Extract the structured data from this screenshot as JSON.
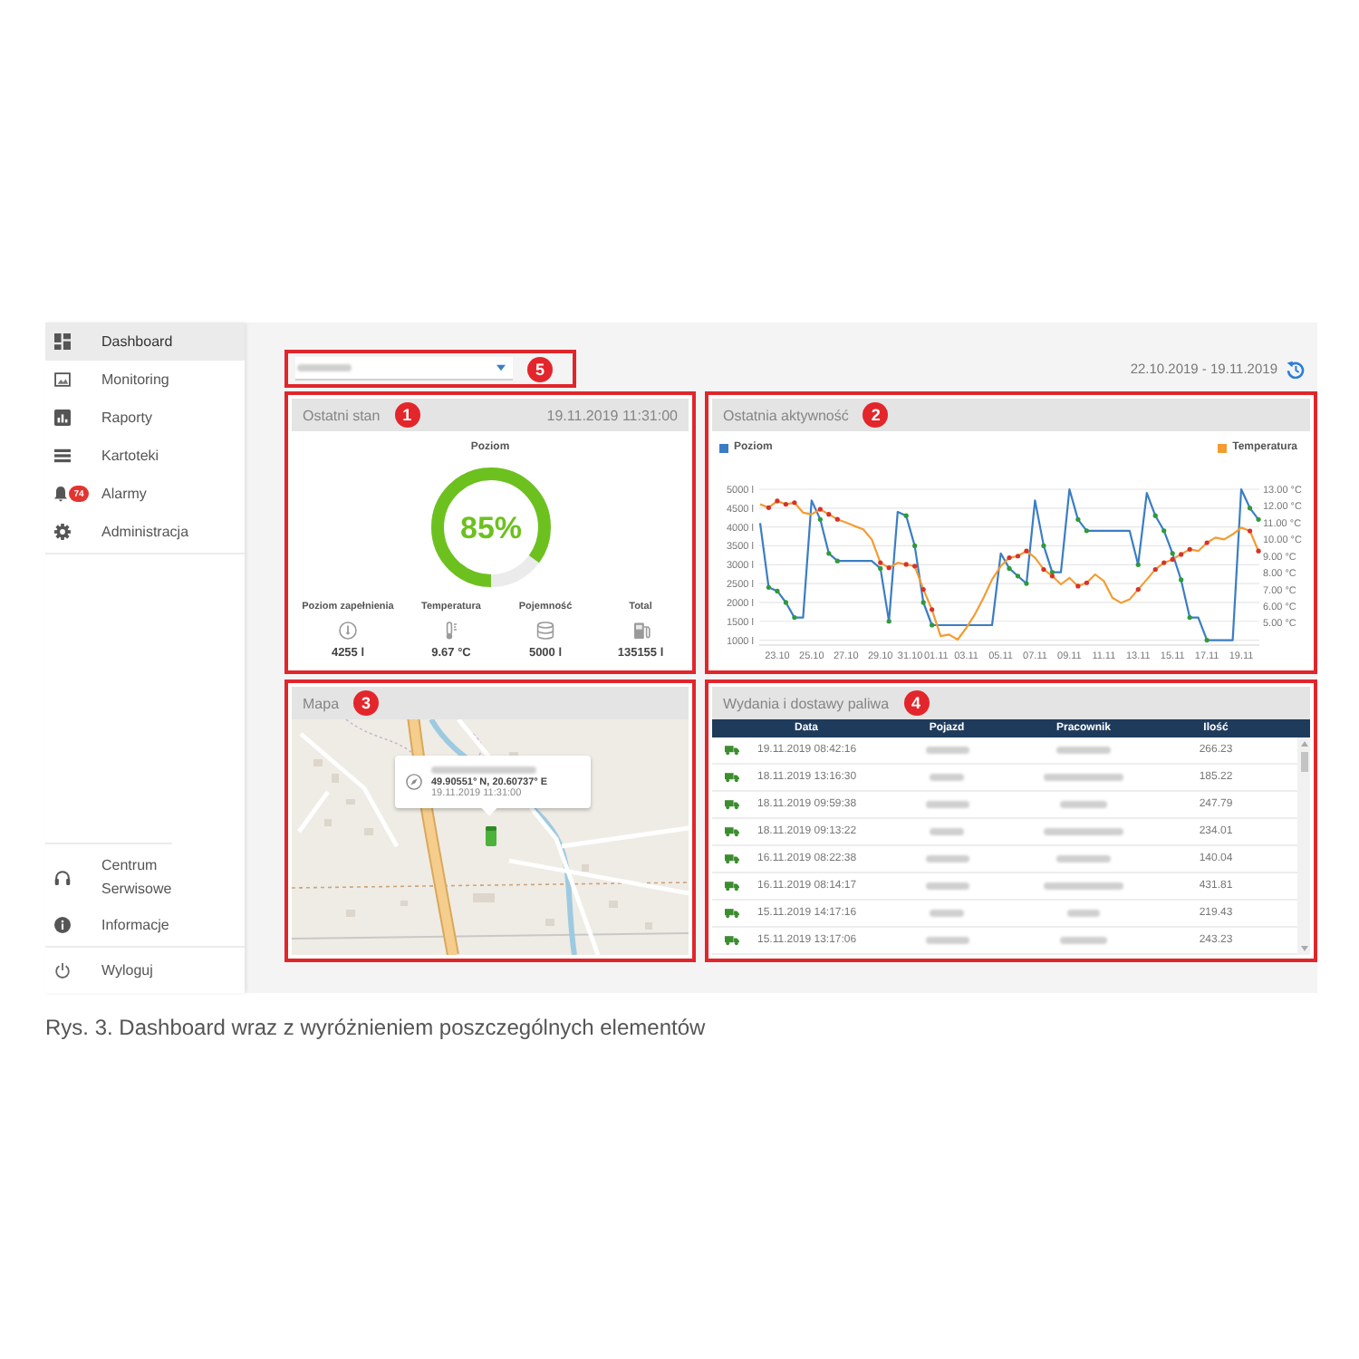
{
  "sidebar": {
    "items": [
      {
        "label": "Dashboard",
        "selected": true
      },
      {
        "label": "Monitoring",
        "selected": false
      },
      {
        "label": "Raporty",
        "selected": false
      },
      {
        "label": "Kartoteki",
        "selected": false
      },
      {
        "label": "Alarmy",
        "selected": false,
        "badge": "74"
      },
      {
        "label": "Administracja",
        "selected": false
      }
    ],
    "footer_items": [
      {
        "label": "Centrum Serwisowe"
      },
      {
        "label": "Informacje"
      },
      {
        "label": "Wyloguj"
      }
    ]
  },
  "toolbar": {
    "selector": {
      "callout": "5"
    },
    "date_range": "22.10.2019 - 19.11.2019"
  },
  "status_panel": {
    "title": "Ostatni stan",
    "callout": "1",
    "timestamp": "19.11.2019 11:31:00",
    "gauge": {
      "label": "Poziom",
      "level": 0.85,
      "reading": "85%"
    },
    "stats": [
      {
        "label": "Poziom zapełnienia",
        "value": "4255 l"
      },
      {
        "label": "Temperatura",
        "value": "9.67 °C"
      },
      {
        "label": "Pojemność",
        "value": "5000 l"
      },
      {
        "label": "Total",
        "value": "135155 l"
      }
    ]
  },
  "activity_panel": {
    "title": "Ostatnia aktywność",
    "callout": "2",
    "chart_data": {
      "type": "line",
      "grid": true,
      "categories": [
        null,
        null,
        "23.10",
        null,
        null,
        null,
        "25.10",
        null,
        null,
        null,
        "27.10",
        null,
        null,
        null,
        "29.10",
        null,
        null,
        null,
        "31.10",
        null,
        "01.11",
        null,
        null,
        null,
        "03.11",
        null,
        null,
        null,
        "05.11",
        null,
        null,
        null,
        "07.11",
        null,
        null,
        null,
        "09.11",
        null,
        null,
        null,
        "11.11",
        null,
        null,
        null,
        "13.11",
        null,
        null,
        null,
        "15.11",
        null,
        null,
        null,
        "17.11",
        null,
        null,
        null,
        "19.11",
        null,
        null
      ],
      "ylim": [
        870,
        5000
      ],
      "yticks": [
        {
          "value": 1000,
          "label": "1000 l"
        },
        {
          "value": 1500,
          "label": "1500 l"
        },
        {
          "value": 2000,
          "label": "2000 l"
        },
        {
          "value": 2500,
          "label": "2500 l"
        },
        {
          "value": 3000,
          "label": "3000 l"
        },
        {
          "value": 3500,
          "label": "3500 l"
        },
        {
          "value": 4000,
          "label": "4000 l"
        },
        {
          "value": 4500,
          "label": "4500 l"
        },
        {
          "value": 5000,
          "label": "5000 l"
        }
      ],
      "y2lim": [
        3.67,
        13
      ],
      "y2ticks": [
        {
          "value": 5,
          "label": "5.00 °C"
        },
        {
          "value": 6,
          "label": "6.00 °C"
        },
        {
          "value": 7,
          "label": "7.00 °C"
        },
        {
          "value": 8,
          "label": "8.00 °C"
        },
        {
          "value": 9,
          "label": "9.00 °C"
        },
        {
          "value": 10,
          "label": "10.00 °C"
        },
        {
          "value": 11,
          "label": "11.00 °C"
        },
        {
          "value": 12,
          "label": "12.00 °C"
        },
        {
          "value": 13,
          "label": "13.00 °C"
        }
      ],
      "series": [
        {
          "name": "Poziom",
          "color": "#3b7dc4",
          "values": [
            4100,
            2400,
            2300,
            2000,
            1600,
            1600,
            4700,
            4200,
            3300,
            3100,
            3100,
            3100,
            3100,
            3100,
            2900,
            1500,
            4400,
            4300,
            3500,
            2000,
            1400,
            1400,
            1400,
            1400,
            1400,
            1400,
            1400,
            1400,
            3300,
            2900,
            2700,
            2500,
            4700,
            3500,
            2800,
            2800,
            5000,
            4200,
            3900,
            3900,
            3900,
            3900,
            3900,
            3900,
            3000,
            4900,
            4300,
            3900,
            3300,
            2600,
            1600,
            1600,
            1000,
            1000,
            1000,
            1000,
            5000,
            4500,
            4200
          ]
        },
        {
          "name": "Temperatura",
          "color": "#f39c32",
          "axis": "y2",
          "values": [
            12.1,
            11.9,
            12.3,
            12.1,
            12.2,
            11.6,
            11.5,
            11.8,
            11.5,
            11.2,
            11.0,
            10.8,
            10.6,
            10.0,
            8.6,
            8.3,
            8.6,
            8.5,
            8.4,
            7.0,
            5.8,
            4.2,
            4.3,
            4.0,
            4.7,
            5.5,
            6.5,
            7.6,
            8.4,
            8.9,
            9.0,
            9.3,
            8.9,
            8.2,
            7.8,
            7.3,
            7.7,
            7.2,
            7.4,
            7.9,
            7.5,
            6.5,
            6.2,
            6.4,
            7.0,
            7.6,
            8.2,
            8.6,
            8.8,
            9.1,
            9.4,
            9.3,
            9.8,
            10.1,
            10.0,
            10.3,
            10.7,
            10.5,
            9.3
          ]
        }
      ]
    }
  },
  "map_panel": {
    "title": "Mapa",
    "callout": "3",
    "popup": {
      "coordinates": "49.90551° N, 20.60737° E",
      "timestamp": "19.11.2019 11:31:00"
    }
  },
  "fuel_panel": {
    "title": "Wydania i dostawy paliwa",
    "callout": "4",
    "columns": [
      "Data",
      "Pojazd",
      "Pracownik",
      "Ilość"
    ],
    "rows": [
      {
        "date": "19.11.2019 08:42:16",
        "amount": "266.23"
      },
      {
        "date": "18.11.2019 13:16:30",
        "amount": "185.22"
      },
      {
        "date": "18.11.2019 09:59:38",
        "amount": "247.79"
      },
      {
        "date": "18.11.2019 09:13:22",
        "amount": "234.01"
      },
      {
        "date": "16.11.2019 08:22:38",
        "amount": "140.04"
      },
      {
        "date": "16.11.2019 08:14:17",
        "amount": "431.81"
      },
      {
        "date": "15.11.2019 14:17:16",
        "amount": "219.43"
      },
      {
        "date": "15.11.2019 13:17:06",
        "amount": "243.23"
      }
    ]
  },
  "caption": "Rys. 3. Dashboard wraz z wyróżnieniem poszczególnych elementów"
}
